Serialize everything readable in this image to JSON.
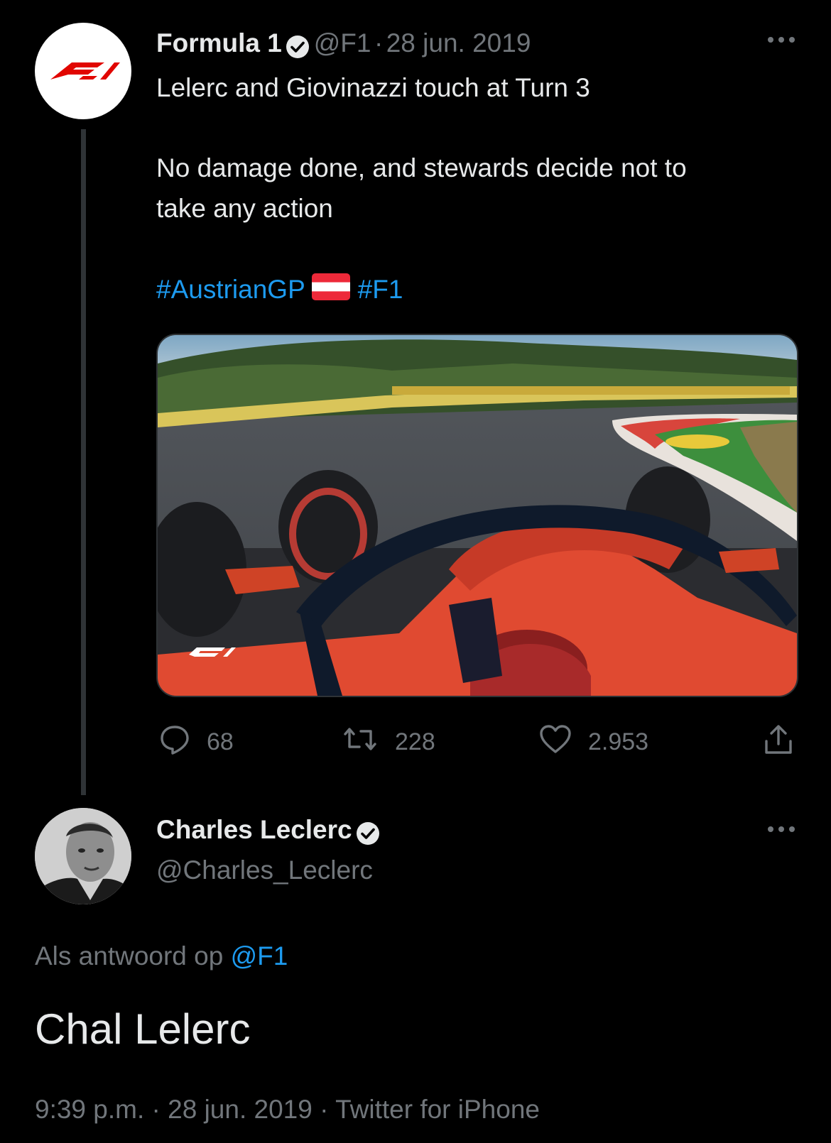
{
  "tweet": {
    "author_name": "Formula 1",
    "author_handle": "@F1",
    "separator": "·",
    "date": "28 jun. 2019",
    "line1": "Lelerc and Giovinazzi touch at Turn 3",
    "line2": "No damage done, and stewards decide not to",
    "line3": "take any action",
    "hashtag1": "#AustrianGP",
    "hashtag2": "#F1",
    "flag_icon": "austria-flag-icon",
    "media_icon": "onboard-video-image",
    "stats": {
      "replies": "68",
      "retweets": "228",
      "likes": "2.953"
    },
    "more_icon": "more-icon",
    "accent_color": "#1d9bf0"
  },
  "reply": {
    "author_name": "Charles Leclerc",
    "author_handle": "@Charles_Leclerc",
    "replying_prefix": "Als antwoord op",
    "replying_to": "@F1",
    "text": "Chal Lelerc",
    "time": "9:39 p.m.",
    "sep": "·",
    "date": "28 jun. 2019",
    "source": "Twitter for iPhone",
    "more_icon": "more-icon"
  }
}
